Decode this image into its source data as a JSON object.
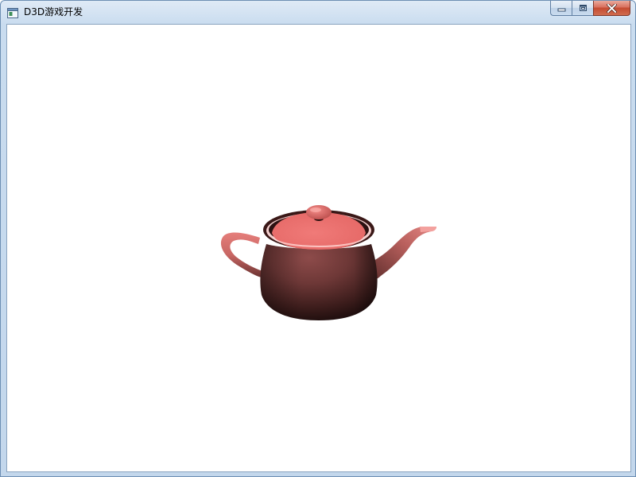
{
  "window": {
    "title": "D3D游戏开发",
    "app_icon": "window-app-icon"
  },
  "caption_buttons": {
    "minimize_icon": "minimize-icon",
    "maximize_icon": "maximize-icon",
    "close_icon": "close-icon",
    "close_color": "#c44a31"
  },
  "scene": {
    "object": "teapot",
    "object_color": "#e06a68",
    "background_color": "#ffffff"
  }
}
